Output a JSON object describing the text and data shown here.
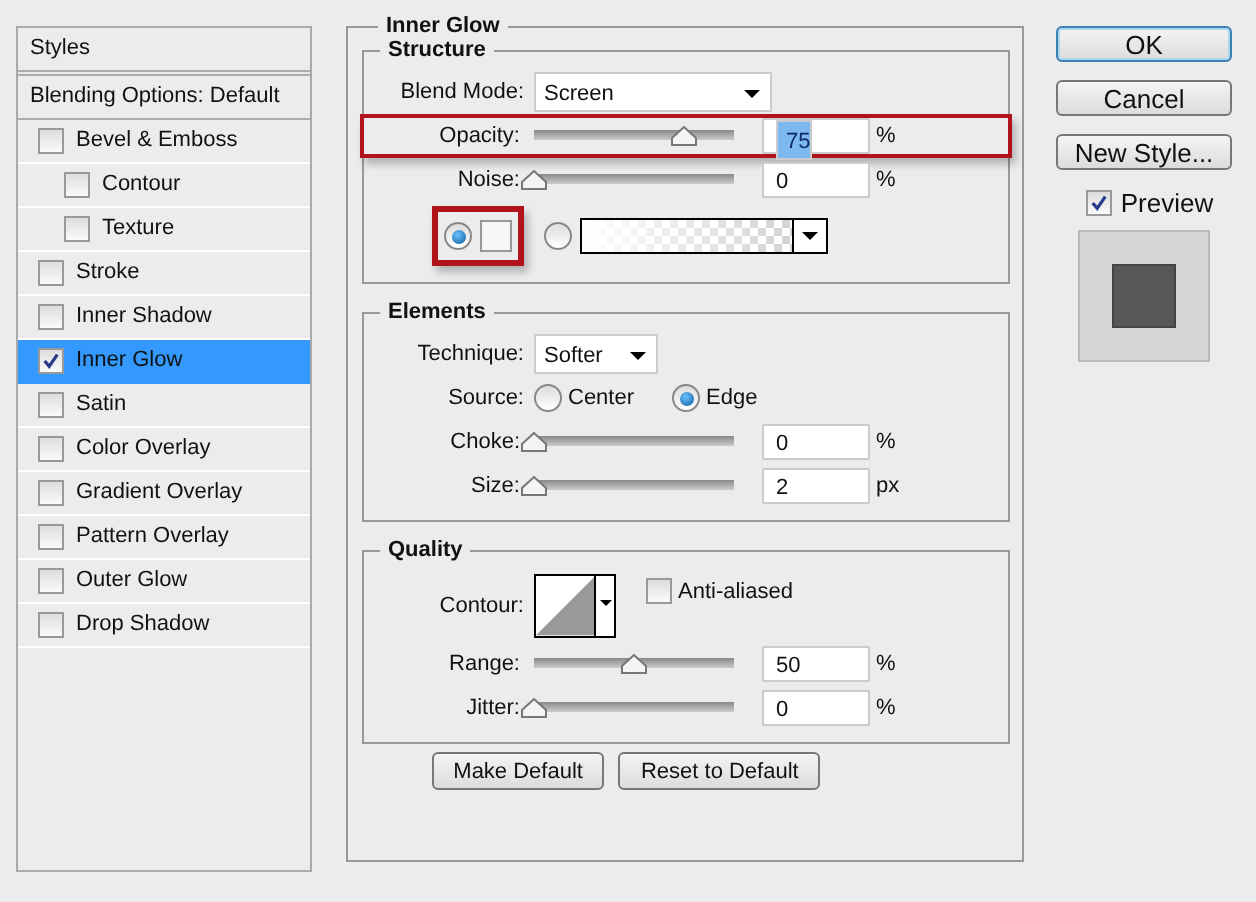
{
  "styles": {
    "title": "Styles",
    "blending": "Blending Options: Default",
    "items": [
      {
        "label": "Bevel & Emboss",
        "checked": false,
        "selected": false,
        "children": [
          {
            "label": "Contour",
            "checked": false,
            "selected": false
          },
          {
            "label": "Texture",
            "checked": false,
            "selected": false
          }
        ]
      },
      {
        "label": "Stroke",
        "checked": false,
        "selected": false
      },
      {
        "label": "Inner Shadow",
        "checked": false,
        "selected": false
      },
      {
        "label": "Inner Glow",
        "checked": true,
        "selected": true
      },
      {
        "label": "Satin",
        "checked": false,
        "selected": false
      },
      {
        "label": "Color Overlay",
        "checked": false,
        "selected": false
      },
      {
        "label": "Gradient Overlay",
        "checked": false,
        "selected": false
      },
      {
        "label": "Pattern Overlay",
        "checked": false,
        "selected": false
      },
      {
        "label": "Outer Glow",
        "checked": false,
        "selected": false
      },
      {
        "label": "Drop Shadow",
        "checked": false,
        "selected": false
      }
    ]
  },
  "inner_glow": {
    "title": "Inner Glow",
    "structure": {
      "title": "Structure",
      "blend_mode": {
        "label": "Blend Mode:",
        "value": "Screen"
      },
      "sliders": [
        {
          "label": "Opacity:",
          "level": 0.75,
          "value": "75",
          "unit": "%",
          "highlighted": true,
          "text_selected": true
        },
        {
          "label": "Noise:",
          "level": 0,
          "value": "0",
          "unit": "%",
          "highlighted": false,
          "text_selected": false
        }
      ],
      "fill": [
        {
          "kind": "color",
          "selected": true,
          "highlighted": true
        },
        {
          "kind": "gradient",
          "selected": false,
          "highlighted": false
        }
      ]
    },
    "elements": {
      "title": "Elements",
      "technique": {
        "label": "Technique:",
        "value": "Softer"
      },
      "source": {
        "label": "Source:",
        "options": [
          {
            "label": "Center",
            "selected": false
          },
          {
            "label": "Edge",
            "selected": true
          }
        ]
      },
      "sliders": [
        {
          "label": "Choke:",
          "level": 0,
          "value": "0",
          "unit": "%",
          "highlighted": false,
          "text_selected": false
        },
        {
          "label": "Size:",
          "level": 0,
          "value": "2",
          "unit": "px",
          "highlighted": false,
          "text_selected": false
        }
      ]
    },
    "quality": {
      "title": "Quality",
      "contour": {
        "label": "Contour:"
      },
      "anti_aliased": {
        "label": "Anti-aliased",
        "checked": false
      },
      "sliders": [
        {
          "label": "Range:",
          "level": 0.5,
          "value": "50",
          "unit": "%",
          "highlighted": false,
          "text_selected": false
        },
        {
          "label": "Jitter:",
          "level": 0,
          "value": "0",
          "unit": "%",
          "highlighted": false,
          "text_selected": false
        }
      ]
    },
    "buttons": [
      "Make Default",
      "Reset to Default"
    ]
  },
  "actions": {
    "buttons": [
      {
        "label": "OK",
        "default": true
      },
      {
        "label": "Cancel",
        "default": false
      },
      {
        "label": "New Style...",
        "default": false
      }
    ],
    "preview": {
      "label": "Preview",
      "checked": true
    }
  }
}
